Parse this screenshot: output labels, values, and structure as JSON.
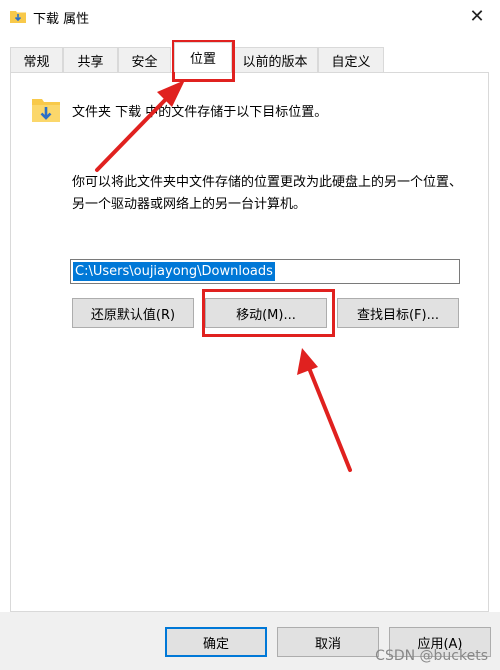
{
  "window": {
    "title": "下载 属性",
    "close_glyph": "✕"
  },
  "tabs": [
    {
      "label": "常规"
    },
    {
      "label": "共享"
    },
    {
      "label": "安全"
    },
    {
      "label": "位置",
      "active": true
    },
    {
      "label": "以前的版本"
    },
    {
      "label": "自定义"
    }
  ],
  "location": {
    "description": "文件夹 下载 中的文件存储于以下目标位置。",
    "info": "你可以将此文件夹中文件存储的位置更改为此硬盘上的另一个位置、另一个驱动器或网络上的另一台计算机。",
    "path": "C:\\Users\\oujiayong\\Downloads",
    "restore_button": "还原默认值(R)",
    "move_button": "移动(M)...",
    "find_button": "查找目标(F)..."
  },
  "footer": {
    "ok": "确定",
    "cancel": "取消",
    "apply": "应用(A)"
  },
  "watermark": "CSDN @buckets",
  "colors": {
    "accent": "#0078d7",
    "highlight": "#e0211f",
    "folder": "#f8c94a"
  }
}
